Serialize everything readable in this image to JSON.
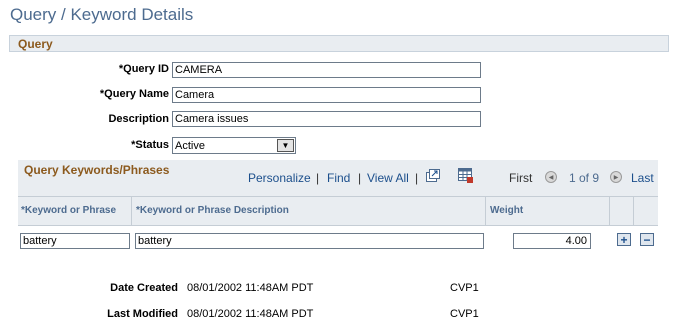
{
  "page": {
    "title": "Query / Keyword Details"
  },
  "query_section": {
    "header": "Query",
    "fields": {
      "query_id": {
        "label": "*Query ID",
        "value": "CAMERA"
      },
      "query_name": {
        "label": "*Query Name",
        "value": "Camera"
      },
      "description": {
        "label": "Description",
        "value": "Camera issues"
      },
      "status": {
        "label": "*Status",
        "value": "Active"
      }
    }
  },
  "grid": {
    "title": "Query Keywords/Phrases",
    "toolbar": {
      "personalize": "Personalize",
      "find": "Find",
      "view_all": "View All",
      "sep": "|",
      "first": "First",
      "count": "1 of 9",
      "last": "Last"
    },
    "columns": {
      "keyword": "*Keyword or Phrase",
      "description": "*Keyword or Phrase Description",
      "weight": "Weight"
    },
    "rows": [
      {
        "keyword": "battery",
        "description": "battery",
        "weight": "4.00"
      }
    ]
  },
  "footer": {
    "date_created": {
      "label": "Date Created",
      "value": "08/01/2002 11:48AM PDT",
      "user": "CVP1"
    },
    "last_modified": {
      "label": "Last Modified",
      "value": "08/01/2002 11:48AM PDT",
      "user": "CVP1"
    }
  },
  "icons": {
    "zoom": "zoom-window-icon",
    "download": "download-grid-icon",
    "prev": "previous-arrow-icon",
    "next": "next-arrow-icon",
    "add": "add-row-icon",
    "delete": "delete-row-icon"
  },
  "colors": {
    "accent": "#4d6b8f",
    "section_title": "#8c5a1e",
    "link": "#1c4f8c",
    "bar": "#e9edf1"
  }
}
